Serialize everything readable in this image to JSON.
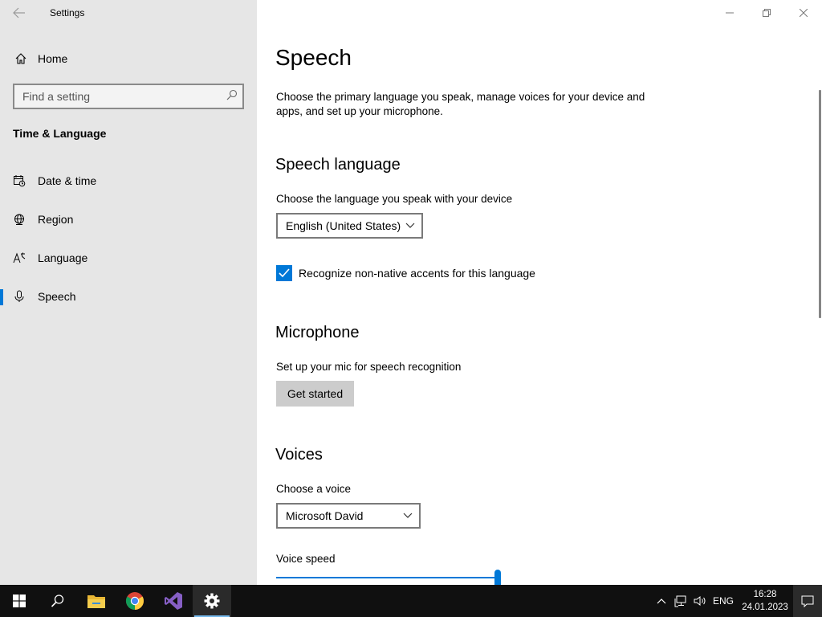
{
  "window": {
    "title": "Settings"
  },
  "nav": {
    "home_label": "Home",
    "search_placeholder": "Find a setting",
    "section_title": "Time & Language",
    "items": [
      {
        "label": "Date & time",
        "icon": "calendar-clock-icon"
      },
      {
        "label": "Region",
        "icon": "globe-icon"
      },
      {
        "label": "Language",
        "icon": "language-icon"
      },
      {
        "label": "Speech",
        "icon": "microphone-icon",
        "selected": true
      }
    ]
  },
  "main": {
    "title": "Speech",
    "description": "Choose the primary language you speak, manage voices for your device and apps, and set up your microphone.",
    "speech_language": {
      "heading": "Speech language",
      "label": "Choose the language you speak with your device",
      "selected": "English (United States)",
      "checkbox_label": "Recognize non-native accents for this language",
      "checkbox_checked": true
    },
    "microphone": {
      "heading": "Microphone",
      "label": "Set up your mic for speech recognition",
      "button": "Get started"
    },
    "voices": {
      "heading": "Voices",
      "label": "Choose a voice",
      "selected": "Microsoft David",
      "speed_label": "Voice speed"
    }
  },
  "taskbar": {
    "apps": [
      "start-icon",
      "search-icon",
      "file-explorer-icon",
      "chrome-icon",
      "visual-studio-icon",
      "settings-gear-icon"
    ],
    "language": "ENG",
    "time": "16:28",
    "date": "24.01.2023"
  },
  "colors": {
    "accent": "#0078d7",
    "nav_bg": "#e6e6e6",
    "taskbar_bg": "#101010"
  }
}
